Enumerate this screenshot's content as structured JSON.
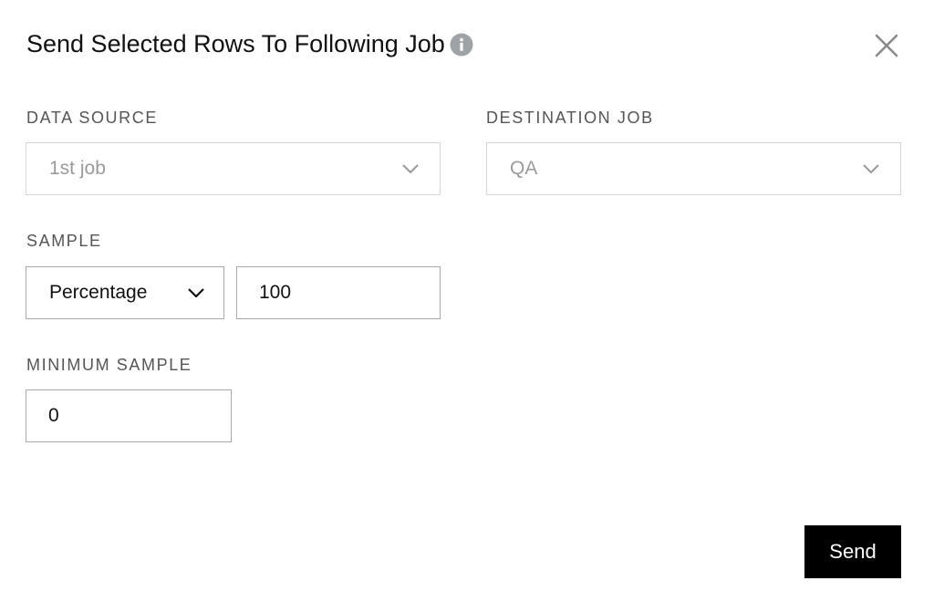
{
  "dialog": {
    "title": "Send Selected Rows To Following Job",
    "info_icon": "info-icon",
    "close_icon": "close-icon"
  },
  "data_source": {
    "label": "DATA SOURCE",
    "value": "1st job",
    "disabled": true
  },
  "destination_job": {
    "label": "DESTINATION JOB",
    "value": "QA",
    "disabled": true
  },
  "sample": {
    "label": "SAMPLE",
    "type_value": "Percentage",
    "amount_value": "100"
  },
  "minimum_sample": {
    "label": "MINIMUM SAMPLE",
    "value": "0"
  },
  "actions": {
    "send_label": "Send"
  },
  "colors": {
    "primary_button_bg": "#000000",
    "primary_button_text": "#ffffff",
    "info_icon": "#9ea3a8",
    "label_text": "#555555",
    "disabled_text": "#9a9a9a"
  }
}
